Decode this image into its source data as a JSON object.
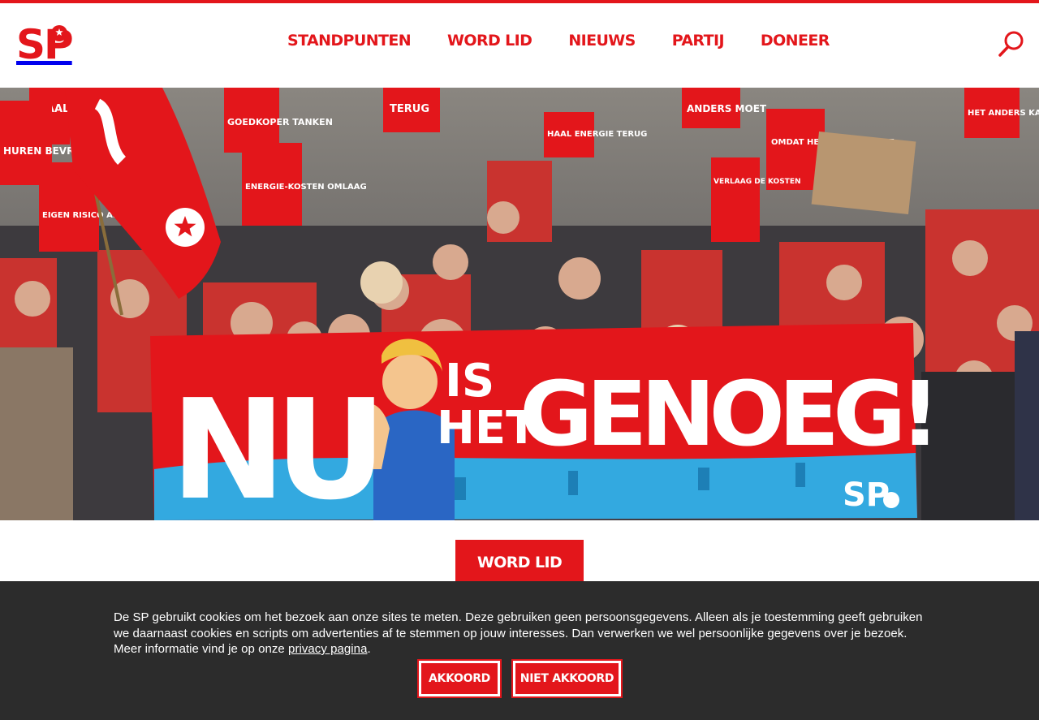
{
  "brand": {
    "logo_text": "SP",
    "accent_color": "#e3161b",
    "logo_icon": "tomato-icon"
  },
  "nav": {
    "items": [
      {
        "label": "STANDPUNTEN"
      },
      {
        "label": "WORD LID"
      },
      {
        "label": "NIEUWS"
      },
      {
        "label": "PARTIJ"
      },
      {
        "label": "DONEER"
      }
    ],
    "search_icon": "search-icon"
  },
  "hero": {
    "banner_word_1": "NU",
    "banner_word_2": "IS",
    "banner_word_3": "HET",
    "banner_word_4": "GENOEG!",
    "banner_logo": "SP",
    "signs": [
      "HAAL",
      "HUREN BEVRIEZEN",
      "GOEDKOPER TANKEN",
      "ENERGIE-KOSTEN OMLAAG",
      "EIGEN RISICO AFSCHAFFEN",
      "TERUG",
      "HAAL ENERGIE TERUG",
      "ANDERS MOET",
      "OMDAT HET ANDERS MOET",
      "VERLAAG DE KOSTEN",
      "HET ANDERS KAN"
    ]
  },
  "cta": {
    "label": "WORD LID"
  },
  "cookie": {
    "text_before_link": "De SP gebruikt cookies om het bezoek aan onze sites te meten. Deze gebruiken geen persoonsgegevens. Alleen als je toestemming geeft gebruiken we daarnaast cookies en scripts om advertenties af te stemmen op jouw interesses. Dan verwerken we wel persoonlijke gegevens over je bezoek. Meer informatie vind je op onze ",
    "link_text": "privacy pagina",
    "text_after_link": ".",
    "accept_label": "AKKOORD",
    "decline_label": "NIET AKKOORD",
    "background_color": "#2c2c2c"
  }
}
